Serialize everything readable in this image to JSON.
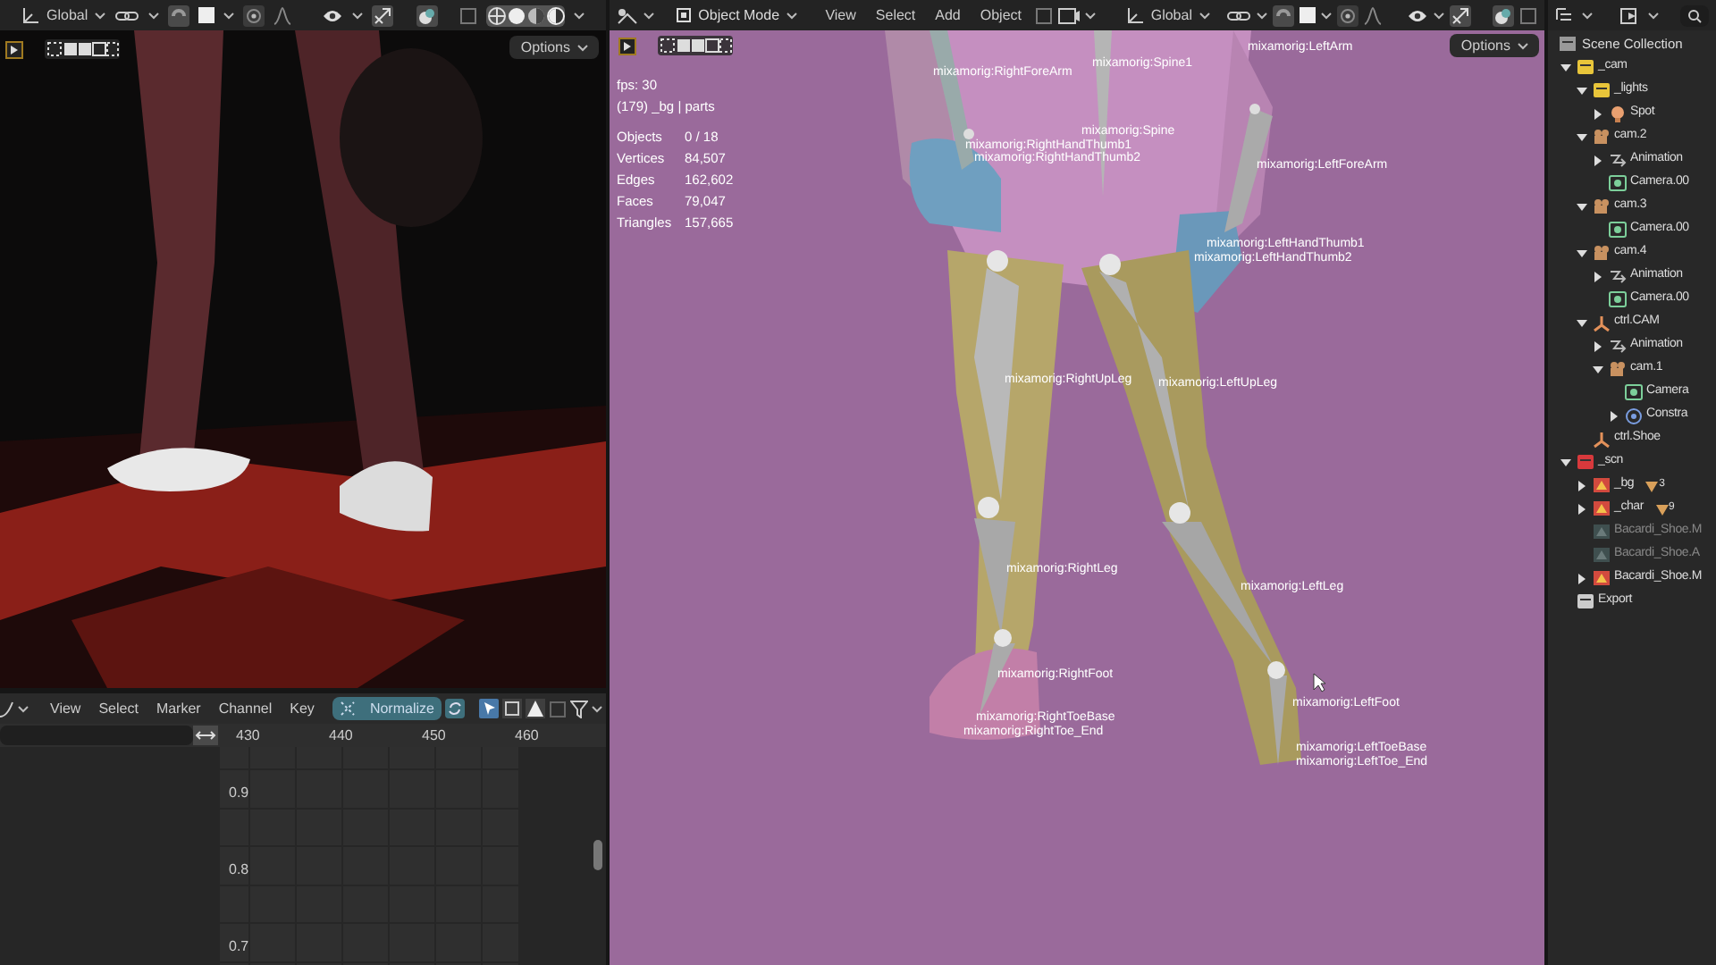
{
  "render_view": {
    "orientation": "Global",
    "options": "Options"
  },
  "graph_editor": {
    "menus": [
      "View",
      "Select",
      "Marker",
      "Channel",
      "Key"
    ],
    "normalize": {
      "label": "Normalize",
      "selected": true
    },
    "frame_ticks": [
      "430",
      "440",
      "450",
      "460"
    ],
    "value_ticks": [
      "0.9",
      "0.8",
      "0.7"
    ]
  },
  "viewport": {
    "mode": "Object Mode",
    "menus": [
      "View",
      "Select",
      "Add",
      "Object"
    ],
    "orientation": "Global",
    "options": "Options",
    "stats": {
      "fps": "fps: 30",
      "context": "(179) _bg | parts",
      "rows": [
        {
          "label": "Objects",
          "value": "0 / 18"
        },
        {
          "label": "Vertices",
          "value": "84,507"
        },
        {
          "label": "Edges",
          "value": "162,602"
        },
        {
          "label": "Faces",
          "value": "79,047"
        },
        {
          "label": "Triangles",
          "value": "157,665"
        }
      ]
    },
    "bone_labels": [
      "mixamorig:LeftArm",
      "mixamorig:Spine1",
      "mixamorig:RightForeArm",
      "mixamorig:Spine",
      "mixamorig:RightHandThumb1",
      "mixamorig:RightHandThumb2",
      "mixamorig:LeftForeArm",
      "mixamorig:LeftHandThumb1",
      "mixamorig:LeftHandThumb2",
      "mixamorig:RightUpLeg",
      "mixamorig:LeftUpLeg",
      "mixamorig:RightLeg",
      "mixamorig:LeftLeg",
      "mixamorig:RightFoot",
      "mixamorig:LeftFoot",
      "mixamorig:RightToeBase",
      "mixamorig:RightToe_End",
      "mixamorig:LeftToeBase",
      "mixamorig:LeftToe_End"
    ]
  },
  "outliner": {
    "title": "Scene Collection",
    "tree": [
      {
        "label": "_cam",
        "kind": "collection",
        "color": "#e8c53a",
        "expanded": true,
        "children": [
          {
            "label": "_lights",
            "kind": "collection",
            "color": "#e8c53a",
            "expanded": true,
            "children": [
              {
                "label": "Spot",
                "kind": "light",
                "expanded": false
              }
            ]
          },
          {
            "label": "cam.2",
            "kind": "camera",
            "expanded": true,
            "children": [
              {
                "label": "Animation",
                "kind": "action",
                "expanded": false
              },
              {
                "label": "Camera.00",
                "kind": "camera_data"
              }
            ]
          },
          {
            "label": "cam.3",
            "kind": "camera",
            "expanded": true,
            "children": [
              {
                "label": "Camera.00",
                "kind": "camera_data"
              }
            ]
          },
          {
            "label": "cam.4",
            "kind": "camera",
            "expanded": true,
            "children": [
              {
                "label": "Animation",
                "kind": "action",
                "expanded": false
              },
              {
                "label": "Camera.00",
                "kind": "camera_data"
              }
            ]
          },
          {
            "label": "ctrl.CAM",
            "kind": "empty",
            "expanded": true,
            "children": [
              {
                "label": "Animation",
                "kind": "action",
                "expanded": false
              },
              {
                "label": "cam.1",
                "kind": "camera",
                "expanded": true,
                "children": [
                  {
                    "label": "Camera",
                    "kind": "camera_data"
                  },
                  {
                    "label": "Constra",
                    "kind": "constraint",
                    "expanded": false
                  }
                ]
              }
            ]
          },
          {
            "label": "ctrl.Shoe",
            "kind": "empty"
          }
        ]
      },
      {
        "label": "_scn",
        "kind": "collection",
        "color": "#d8393c",
        "expanded": true,
        "children": [
          {
            "label": "_bg",
            "kind": "mesh",
            "expanded": false,
            "disabled": false,
            "count": "3"
          },
          {
            "label": "_char",
            "kind": "mesh",
            "expanded": false,
            "disabled": false,
            "count": "9"
          },
          {
            "label": "Bacardi_Shoe.M",
            "kind": "mesh",
            "disabled": true
          },
          {
            "label": "Bacardi_Shoe.A",
            "kind": "mesh",
            "disabled": true
          },
          {
            "label": "Bacardi_Shoe.M",
            "kind": "mesh",
            "expanded": false,
            "disabled": false
          }
        ]
      },
      {
        "label": "Export",
        "kind": "collection",
        "color": "#cccccc"
      }
    ]
  }
}
